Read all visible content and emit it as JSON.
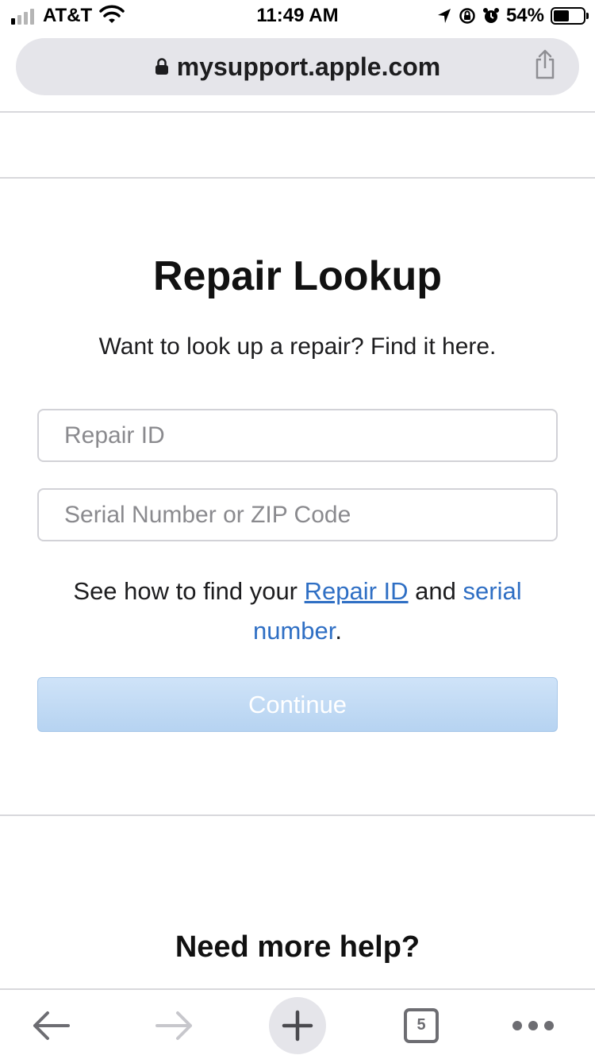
{
  "status_bar": {
    "carrier": "AT&T",
    "time": "11:49 AM",
    "battery_percent": "54%",
    "battery_level": 0.54,
    "signal_bars_on": 1,
    "signal_bars_total": 4,
    "icons": [
      "signal-icon",
      "wifi-icon",
      "location-arrow-icon",
      "orientation-lock-icon",
      "alarm-icon",
      "battery-icon"
    ]
  },
  "browser": {
    "url": "mysupport.apple.com",
    "secure_icon": "lock-icon",
    "share_icon": "share-icon"
  },
  "main": {
    "title": "Repair Lookup",
    "subtitle": "Want to look up a repair? Find it here.",
    "repair_id_placeholder": "Repair ID",
    "serial_placeholder": "Serial Number or ZIP Code",
    "help_prefix": "See how to find your ",
    "help_link_repair": "Repair ID",
    "help_and": " and ",
    "help_link_serial": "serial number",
    "help_suffix": ".",
    "continue_label": "Continue",
    "more_help": "Need more help?"
  },
  "toolbar": {
    "back_icon": "back-arrow-icon",
    "forward_icon": "forward-arrow-icon",
    "new_tab_icon": "plus-icon",
    "tab_count": "5",
    "menu_icon": "more-icon"
  },
  "colors": {
    "link": "#2f6fc4",
    "continue_bg": "#b6d3f1",
    "url_bar_bg": "#e5e5ea"
  }
}
